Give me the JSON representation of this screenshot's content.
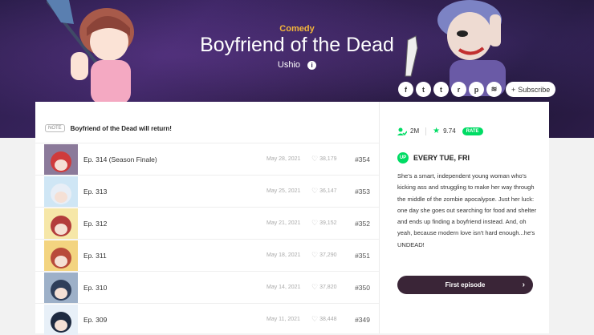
{
  "hero": {
    "genre": "Comedy",
    "title": "Boyfriend of the Dead",
    "author": "Ushio",
    "info_icon": "i"
  },
  "social": {
    "items": [
      {
        "name": "facebook-icon",
        "glyph": "f"
      },
      {
        "name": "twitter-icon",
        "glyph": "t"
      },
      {
        "name": "tumblr-icon",
        "glyph": "t"
      },
      {
        "name": "reddit-icon",
        "glyph": "r"
      },
      {
        "name": "pinterest-icon",
        "glyph": "p"
      },
      {
        "name": "rss-icon",
        "glyph": "≋"
      }
    ],
    "subscribe_label": "Subscribe",
    "subscribe_icon": "+"
  },
  "notice": {
    "badge": "NOTE",
    "text": "Boyfriend of the Dead will return!"
  },
  "episodes": [
    {
      "title": "Ep. 314 (Season Finale)",
      "date": "May 28, 2021",
      "likes": "38,179",
      "number": "#354",
      "thumb_bg": "#8b7a9a",
      "thumb_fg": "#cf3b3b"
    },
    {
      "title": "Ep. 313",
      "date": "May 25, 2021",
      "likes": "36,147",
      "number": "#353",
      "thumb_bg": "#cfe6f5",
      "thumb_fg": "#e8eef6"
    },
    {
      "title": "Ep. 312",
      "date": "May 21, 2021",
      "likes": "39,152",
      "number": "#352",
      "thumb_bg": "#f6e7a8",
      "thumb_fg": "#b33c3c"
    },
    {
      "title": "Ep. 311",
      "date": "May 18, 2021",
      "likes": "37,290",
      "number": "#351",
      "thumb_bg": "#f3d480",
      "thumb_fg": "#b84a3a"
    },
    {
      "title": "Ep. 310",
      "date": "May 14, 2021",
      "likes": "37,820",
      "number": "#350",
      "thumb_bg": "#9db0c8",
      "thumb_fg": "#2e3e5a"
    },
    {
      "title": "Ep. 309",
      "date": "May 11, 2021",
      "likes": "38,448",
      "number": "#349",
      "thumb_bg": "#e8f0f8",
      "thumb_fg": "#1e2a40"
    }
  ],
  "stats": {
    "subscribers": "2M",
    "rating": "9.74",
    "rate_label": "RATE"
  },
  "schedule": {
    "badge": "UP",
    "text": "EVERY TUE, FRI"
  },
  "summary": "She's a smart, independent young woman who's kicking ass and struggling to make her way through the middle of the zombie apocalypse. Just her luck: one day she goes out searching for food and shelter and ends up finding a boyfriend instead. And, oh yeah, because modern love isn't hard enough...he's UNDEAD!",
  "first_episode": {
    "label": "First episode",
    "chevron": "›"
  },
  "colors": {
    "accent_green": "#00dc64",
    "genre_yellow": "#f4b63a",
    "button_dark": "#3a2537"
  }
}
